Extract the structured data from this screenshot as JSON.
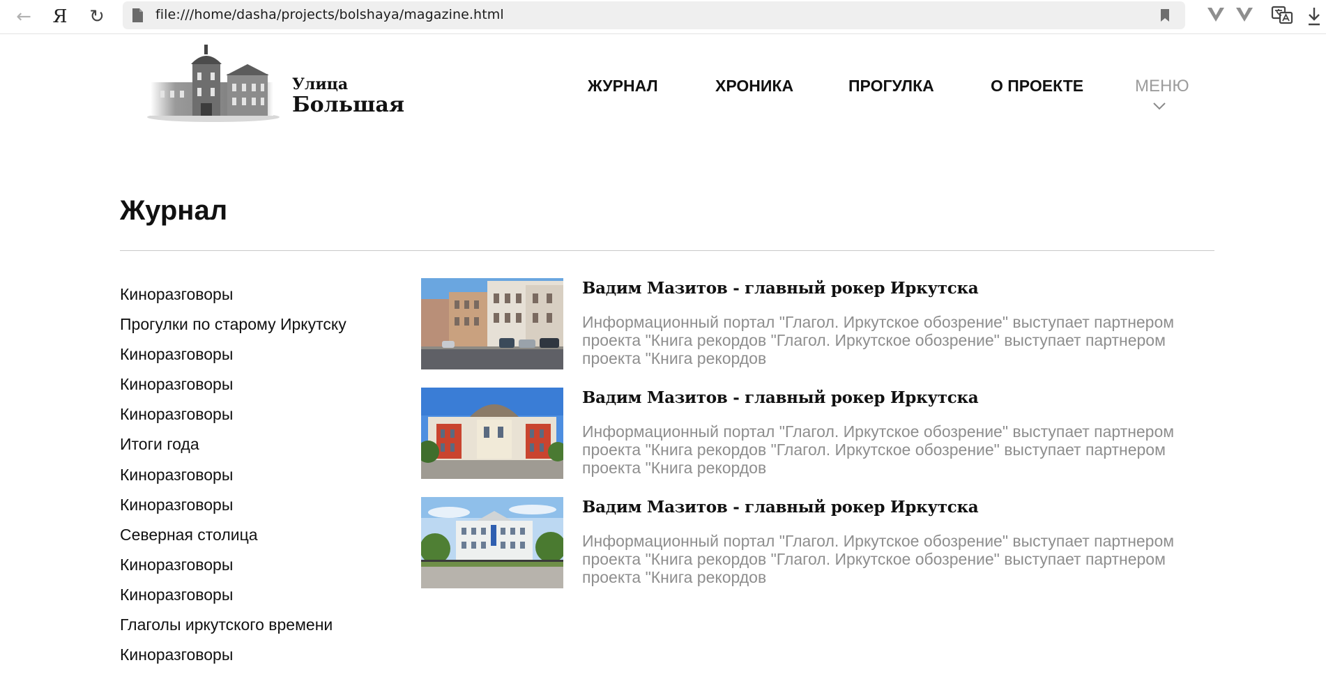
{
  "browser": {
    "url": "file:///home/dasha/projects/bolshaya/magazine.html",
    "yandex_label": "Я"
  },
  "site": {
    "logo_line1": "Улица",
    "logo_line2": "Большая",
    "nav": [
      "ЖУРНАЛ",
      "ХРОНИКА",
      "ПРОГУЛКА",
      "О ПРОЕКТЕ"
    ],
    "menu_label": "МЕНЮ"
  },
  "page": {
    "title": "Журнал",
    "categories": [
      "Киноразговоры",
      "Прогулки по старому Иркутску",
      "Киноразговоры",
      "Киноразговоры",
      "Киноразговоры",
      "Итоги года",
      "Киноразговоры",
      "Киноразговоры",
      "Северная столица",
      "Киноразговоры",
      "Киноразговоры",
      "Глаголы иркутского времени",
      "Киноразговоры"
    ],
    "articles": [
      {
        "title": "Вадим Мазитов - главный рокер Иркутска",
        "text": "Информационный портал \"Глагол. Иркутское обозрение\" выступает партнером проекта \"Книга рекордов \"Глагол. Иркутское обозрение\" выступает партнером проекта \"Книга рекордов"
      },
      {
        "title": "Вадим Мазитов - главный рокер Иркутска",
        "text": "Информационный портал \"Глагол. Иркутское обозрение\" выступает партнером проекта \"Книга рекордов \"Глагол. Иркутское обозрение\" выступает партнером проекта \"Книга рекордов"
      },
      {
        "title": "Вадим Мазитов - главный рокер Иркутска",
        "text": "Информационный портал \"Глагол. Иркутское обозрение\" выступает партнером проекта \"Книга рекордов \"Глагол. Иркутское обозрение\" выступает партнером проекта \"Книга рекордов"
      }
    ]
  }
}
